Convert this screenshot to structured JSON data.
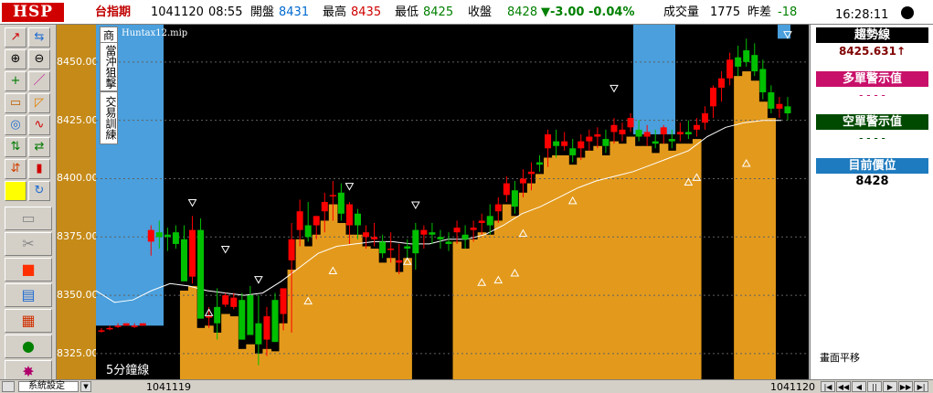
{
  "header": {
    "logo": "HSP",
    "symbol": "台指期",
    "date": "1041120",
    "time": "08:55",
    "open_label": "開盤",
    "open": "8431",
    "high_label": "最高",
    "high": "8435",
    "low_label": "最低",
    "low": "8425",
    "close_label": "收盤",
    "close": "8428",
    "change": "▼-3.00 -0.04%",
    "volume_label": "成交量",
    "volume": "1775",
    "diff_label": "昨差",
    "diff": "-18",
    "clock": "16:28:11"
  },
  "toolbar": {
    "icons": [
      "draw-line-icon",
      "split-icon",
      "zoom-in-icon",
      "zoom-out-icon",
      "crosshair-icon",
      "pen-icon",
      "rectangle-icon",
      "angle-icon",
      "circle-icon",
      "wave-icon",
      "chart-toggle-icon",
      "compare-icon",
      "arrow-swap-icon",
      "candle-icon",
      "color-square-icon",
      "refresh-icon",
      "folder-icon",
      "cut-icon",
      "stop-icon",
      "note-icon",
      "grid-icon",
      "glove-icon",
      "burst-icon"
    ]
  },
  "chart": {
    "side_buttons": [
      "商",
      "當沖狙擊",
      "交易訓練"
    ],
    "file_label": "Huntax12.mip",
    "period_label": "5分鐘線",
    "y_ticks": [
      "8450.00",
      "8425.00",
      "8400.00",
      "8375.00",
      "8350.00",
      "8325.00"
    ],
    "date_left": "1041119",
    "date_right": "1041120"
  },
  "chart_data": {
    "type": "candlestick",
    "title": "5分鐘線",
    "ylim": [
      8314,
      8466
    ],
    "y_ticks": [
      8325,
      8350,
      8375,
      8400,
      8425,
      8450
    ],
    "candles": [
      [
        8335,
        8336,
        8334,
        8335
      ],
      [
        8336,
        8337,
        8335,
        8336
      ],
      [
        8337,
        8338,
        8336,
        8337
      ],
      [
        8337,
        8338,
        8337,
        8338
      ],
      [
        8337,
        8338,
        8336,
        8337
      ],
      [
        8337,
        8338,
        8337,
        8338
      ],
      [
        8373,
        8380,
        8367,
        8378
      ],
      [
        8377,
        8382,
        8370,
        8375
      ],
      [
        8376,
        8379,
        8369,
        8375
      ],
      [
        8377,
        8380,
        8370,
        8372
      ],
      [
        8374,
        8380,
        8356,
        8356
      ],
      [
        8358,
        8384,
        8355,
        8378
      ],
      [
        8378,
        8383,
        8340,
        8340
      ],
      [
        8341,
        8345,
        8336,
        8341
      ],
      [
        8345,
        8353,
        8331,
        8338
      ],
      [
        8346,
        8351,
        8345,
        8350
      ],
      [
        8345,
        8351,
        8344,
        8349
      ],
      [
        8348,
        8351,
        8331,
        8331
      ],
      [
        8350,
        8354,
        8334,
        8333
      ],
      [
        8338,
        8350,
        8320,
        8329
      ],
      [
        8331,
        8345,
        8324,
        8341
      ],
      [
        8348,
        8351,
        8330,
        8330
      ],
      [
        8342,
        8353,
        8335,
        8353
      ],
      [
        8365,
        8381,
        8334,
        8374
      ],
      [
        8378,
        8391,
        8371,
        8386
      ],
      [
        8380,
        8390,
        8373,
        8375
      ],
      [
        8380,
        8384,
        8374,
        8384
      ],
      [
        8386,
        8394,
        8377,
        8390
      ],
      [
        8393,
        8399,
        8382,
        8393
      ],
      [
        8394,
        8398,
        8382,
        8385
      ],
      [
        8380,
        8390,
        8372,
        8389
      ],
      [
        8385,
        8387,
        8374,
        8380
      ],
      [
        8375,
        8380,
        8370,
        8377
      ],
      [
        8374,
        8381,
        8371,
        8375
      ],
      [
        8373,
        8376,
        8366,
        8368
      ],
      [
        8370,
        8377,
        8364,
        8370
      ],
      [
        8364,
        8372,
        8359,
        8365
      ],
      [
        8371,
        8374,
        8366,
        8370
      ],
      [
        8378,
        8381,
        8361,
        8368
      ],
      [
        8376,
        8380,
        8370,
        8378
      ],
      [
        8377,
        8381,
        8372,
        8376
      ],
      [
        8375,
        8378,
        8370,
        8374
      ],
      [
        8373,
        8377,
        8369,
        8372
      ],
      [
        8377,
        8382,
        8372,
        8379
      ],
      [
        8376,
        8380,
        8370,
        8374
      ],
      [
        8378,
        8382,
        8373,
        8379
      ],
      [
        8381,
        8385,
        8376,
        8382
      ],
      [
        8384,
        8389,
        8376,
        8380
      ],
      [
        8386,
        8392,
        8381,
        8389
      ],
      [
        8393,
        8401,
        8390,
        8398
      ],
      [
        8395,
        8399,
        8385,
        8388
      ],
      [
        8398,
        8404,
        8392,
        8400
      ],
      [
        8402,
        8407,
        8395,
        8403
      ],
      [
        8407,
        8410,
        8403,
        8406
      ],
      [
        8413,
        8421,
        8405,
        8419
      ],
      [
        8416,
        8421,
        8409,
        8414
      ],
      [
        8414,
        8420,
        8412,
        8416
      ],
      [
        8413,
        8417,
        8407,
        8410
      ],
      [
        8413,
        8419,
        8408,
        8416
      ],
      [
        8416,
        8421,
        8412,
        8418
      ],
      [
        8418,
        8422,
        8413,
        8419
      ],
      [
        8417,
        8421,
        8411,
        8414
      ],
      [
        8420,
        8426,
        8415,
        8423
      ],
      [
        8419,
        8424,
        8416,
        8421
      ],
      [
        8422,
        8428,
        8420,
        8426
      ],
      [
        8421,
        8425,
        8416,
        8418
      ],
      [
        8418,
        8423,
        8414,
        8420
      ],
      [
        8416,
        8421,
        8413,
        8415
      ],
      [
        8419,
        8423,
        8415,
        8422
      ],
      [
        8417,
        8421,
        8413,
        8416
      ],
      [
        8419,
        8424,
        8416,
        8420
      ],
      [
        8420,
        8425,
        8417,
        8419
      ],
      [
        8421,
        8426,
        8418,
        8423
      ],
      [
        8424,
        8431,
        8421,
        8428
      ],
      [
        8431,
        8440,
        8426,
        8439
      ],
      [
        8439,
        8446,
        8433,
        8443
      ],
      [
        8443,
        8454,
        8440,
        8451
      ],
      [
        8452,
        8457,
        8444,
        8448
      ],
      [
        8455,
        8460,
        8448,
        8450
      ],
      [
        8453,
        8458,
        8444,
        8446
      ],
      [
        8447,
        8451,
        8434,
        8437
      ],
      [
        8437,
        8440,
        8428,
        8430
      ],
      [
        8430,
        8435,
        8426,
        8432
      ],
      [
        8431,
        8435,
        8425,
        8428
      ]
    ],
    "trend_line": [
      8352,
      8347,
      8348,
      8352,
      8355,
      8354,
      8352,
      8351,
      8350,
      8351,
      8356,
      8362,
      8368,
      8371,
      8372,
      8373,
      8373,
      8372,
      8372,
      8374,
      8374,
      8376,
      8380,
      8385,
      8388,
      8392,
      8396,
      8399,
      8401,
      8403,
      8406,
      8409,
      8412,
      8418,
      8422,
      8424,
      8425,
      8425
    ]
  },
  "panel": {
    "trend_label": "趨勢線",
    "trend_value": "8425.631↑",
    "long_label": "多單警示值",
    "long_value": "- - - -",
    "short_label": "空單警示值",
    "short_value": "- - - -",
    "pos_label": "目前價位",
    "pos_value": "8428",
    "footer_note": "畫面平移"
  },
  "bottom": {
    "settings": "系統設定"
  },
  "colors": {
    "up": "#ff0000",
    "down": "#00c000",
    "fill": "#e39a1c",
    "blue": "#4a9fdc",
    "trend_header": "#000000",
    "long_header": "#c8106a",
    "short_header": "#004a00",
    "pos_header": "#1e7bbf"
  }
}
